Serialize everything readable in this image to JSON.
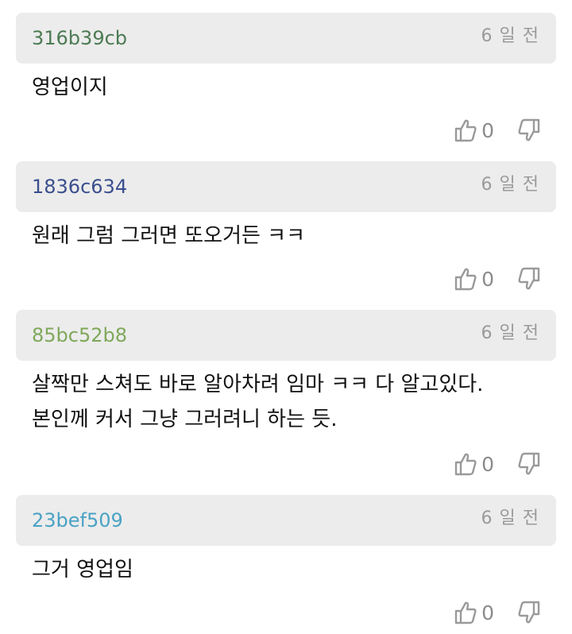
{
  "comments": [
    {
      "user": "316b39cb",
      "user_color": "#4d7b53",
      "time": "6 일 전",
      "lines": [
        "영업이지"
      ],
      "likes": "0"
    },
    {
      "user": "1836c634",
      "user_color": "#3b4f8e",
      "time": "6 일 전",
      "lines": [
        "원래 그럼 그러면 또오거든 ㅋㅋ"
      ],
      "likes": "0"
    },
    {
      "user": "85bc52b8",
      "user_color": "#7fa85a",
      "time": "6 일 전",
      "lines": [
        "살짝만 스쳐도 바로 알아차려 임마 ㅋㅋ 다 알고있다.",
        "본인께 커서 그냥 그러려니 하는 듯."
      ],
      "likes": "0"
    },
    {
      "user": "23bef509",
      "user_color": "#4aa2c4",
      "time": "6 일 전",
      "lines": [
        "그거 영업임"
      ],
      "likes": "0"
    }
  ],
  "icons": {
    "like": "thumbs-up-icon",
    "dislike": "thumbs-down-icon"
  }
}
